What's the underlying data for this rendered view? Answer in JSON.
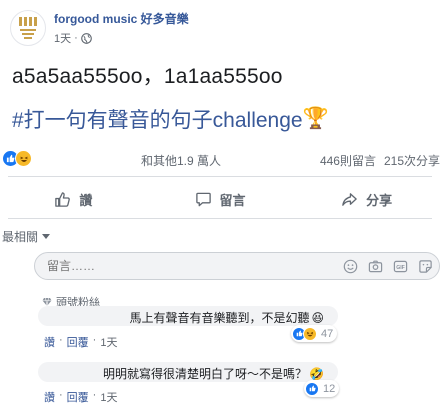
{
  "post": {
    "page_name": "forgood music 好多音樂",
    "time": "1天",
    "line1": "a5a5aa555oo，1a1aa555oo",
    "line2_hash": "#打一句有聲音的句子challenge",
    "trophy": "🏆"
  },
  "reactions": {
    "like_glyph": "👍",
    "haha_glyph": "😆",
    "others": "和其他1.9 萬人",
    "comments": "446則留言",
    "shares": "215次分享"
  },
  "actions": {
    "like": "讚",
    "comment": "留言",
    "share": "分享"
  },
  "sort": {
    "label": "最相關"
  },
  "compose": {
    "placeholder": "留言……",
    "icons": [
      "smile-icon",
      "camera-icon",
      "gif-icon",
      "sticker-icon"
    ]
  },
  "comments": [
    {
      "badge": "頭號粉絲",
      "text": "馬上有聲音有音樂聽到，不是幻聽",
      "emoji": "😆",
      "reaction_count": "47",
      "like_label": "讚",
      "reply_label": "回覆",
      "time": "1天"
    },
    {
      "badge": "",
      "text": "明明就寫得很清楚明白了呀～不是嗎？",
      "emoji": "🤣",
      "reaction_count": "12",
      "like_label": "讚",
      "reply_label": "回覆",
      "time": "1天"
    }
  ],
  "colors": {
    "link_blue": "#365899",
    "like_blue": "#1877f2",
    "haha_yellow": "#f7b928",
    "meta_gray": "#606770"
  }
}
